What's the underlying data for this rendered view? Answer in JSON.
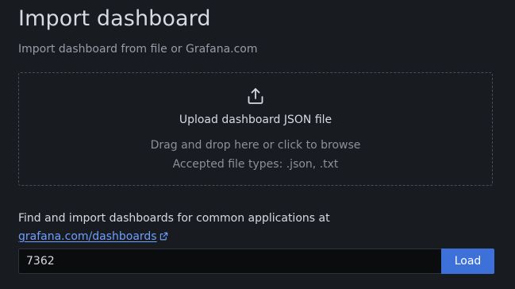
{
  "header": {
    "title": "Import dashboard",
    "subtitle": "Import dashboard from file or Grafana.com"
  },
  "upload": {
    "icon": "upload-icon",
    "title": "Upload dashboard JSON file",
    "hint": "Drag and drop here or click to browse",
    "accepted_types": "Accepted file types: .json, .txt"
  },
  "grafana_com": {
    "label": "Find and import dashboards for common applications at",
    "link_text": "grafana.com/dashboards",
    "link_icon": "external-link-icon",
    "input_value": "7362",
    "load_label": "Load"
  },
  "colors": {
    "background": "#181b1f",
    "link": "#6e9fff",
    "primary_button": "#3d71d9",
    "input_background": "#0b0c0e"
  }
}
